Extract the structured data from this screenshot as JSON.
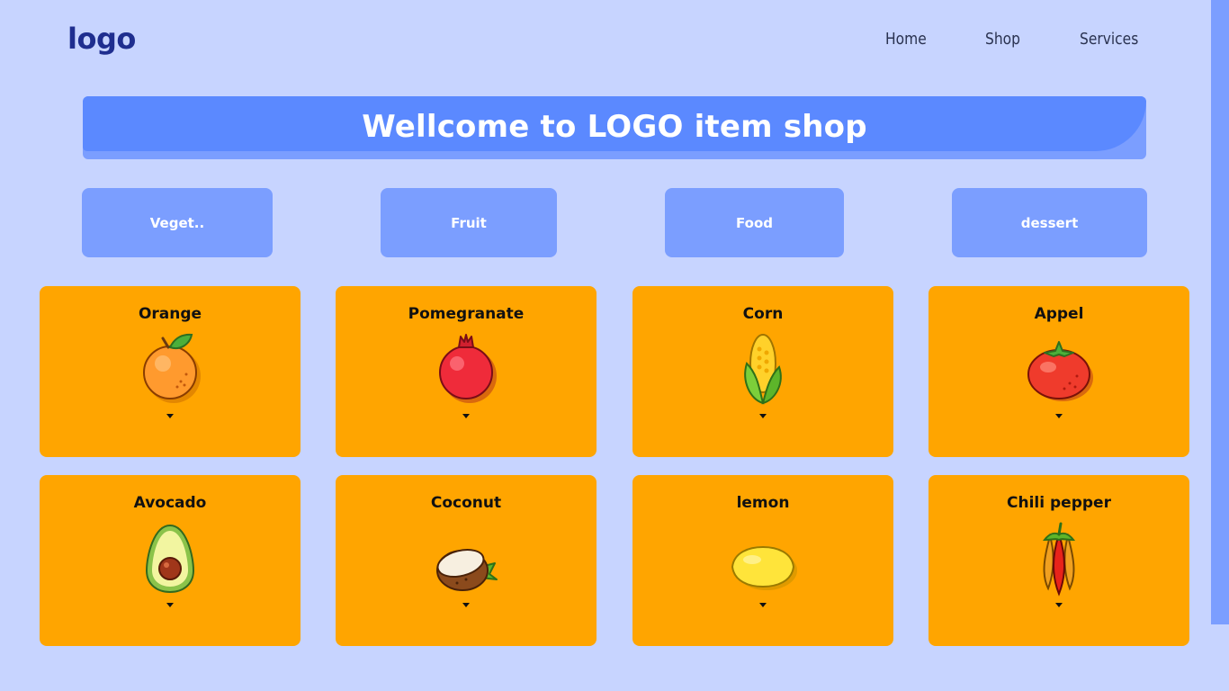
{
  "header": {
    "logo": "logo",
    "nav": [
      {
        "label": "Home"
      },
      {
        "label": "Shop"
      },
      {
        "label": "Services"
      }
    ]
  },
  "banner": {
    "title": "Wellcome to LOGO item shop"
  },
  "categories": [
    {
      "label": "Veget.."
    },
    {
      "label": "Fruit"
    },
    {
      "label": "Food"
    },
    {
      "label": "dessert"
    }
  ],
  "items": [
    {
      "name": "Orange",
      "icon": "orange-icon"
    },
    {
      "name": "Pomegranate",
      "icon": "pomegranate-icon"
    },
    {
      "name": "Corn",
      "icon": "corn-icon"
    },
    {
      "name": "Appel",
      "icon": "tomato-icon"
    },
    {
      "name": "Avocado",
      "icon": "avocado-icon"
    },
    {
      "name": "Coconut",
      "icon": "coconut-icon"
    },
    {
      "name": "lemon",
      "icon": "lemon-icon"
    },
    {
      "name": "Chili pepper",
      "icon": "chili-pepper-icon"
    }
  ],
  "colors": {
    "background": "#c7d4ff",
    "accent": "#5b89ff",
    "button": "#7b9eff",
    "card": "#ffa500",
    "logo": "#1f2e8f"
  }
}
